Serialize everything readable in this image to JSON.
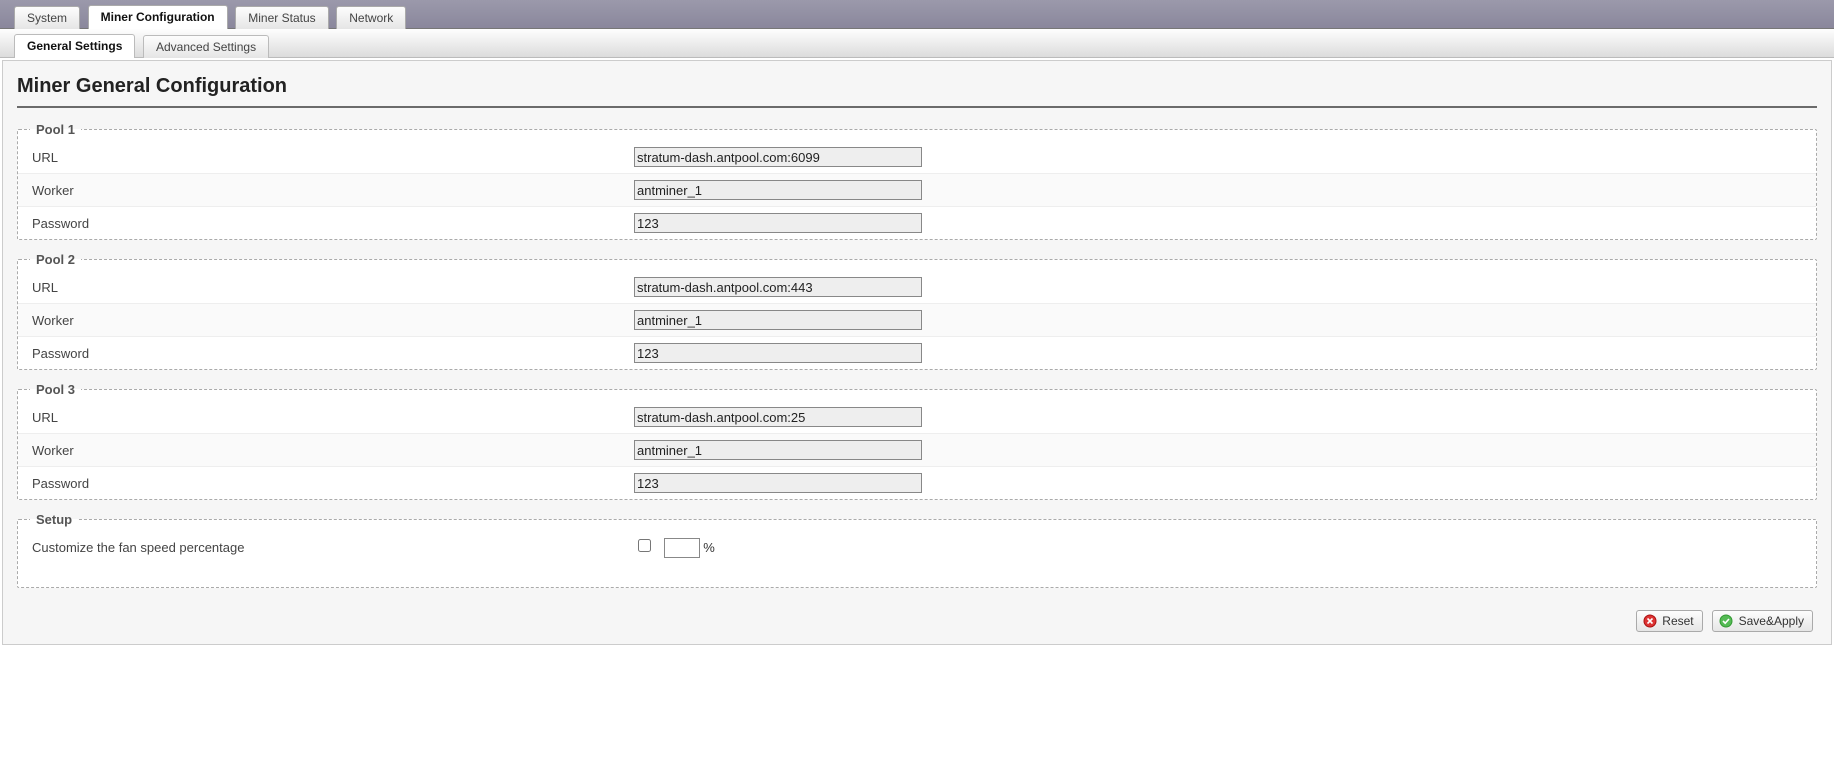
{
  "topTabs": {
    "system": "System",
    "minerConfig": "Miner Configuration",
    "minerStatus": "Miner Status",
    "network": "Network"
  },
  "subTabs": {
    "general": "General Settings",
    "advanced": "Advanced Settings"
  },
  "pageTitle": "Miner General Configuration",
  "labels": {
    "url": "URL",
    "worker": "Worker",
    "password": "Password",
    "fan": "Customize the fan speed percentage",
    "percent": "%"
  },
  "legends": {
    "pool1": "Pool 1",
    "pool2": "Pool 2",
    "pool3": "Pool 3",
    "setup": "Setup"
  },
  "pools": [
    {
      "url": "stratum-dash.antpool.com:6099",
      "worker": "antminer_1",
      "password": "123"
    },
    {
      "url": "stratum-dash.antpool.com:443",
      "worker": "antminer_1",
      "password": "123"
    },
    {
      "url": "stratum-dash.antpool.com:25",
      "worker": "antminer_1",
      "password": "123"
    }
  ],
  "setup": {
    "fanChecked": false,
    "fanValue": ""
  },
  "buttons": {
    "reset": "Reset",
    "saveApply": "Save&Apply"
  }
}
